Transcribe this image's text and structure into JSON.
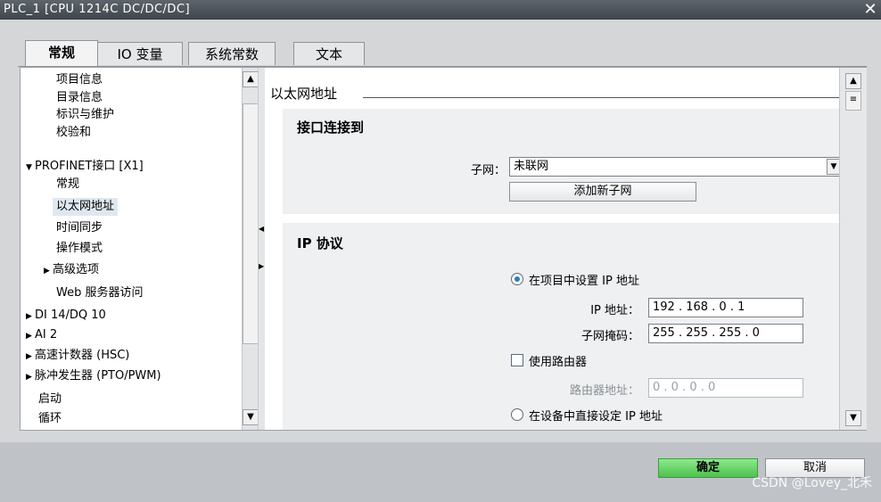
{
  "window": {
    "title": "PLC_1 [CPU 1214C DC/DC/DC]"
  },
  "tabs": [
    {
      "label": "常规"
    },
    {
      "label": "IO 变量"
    },
    {
      "label": "系统常数"
    },
    {
      "label": "文本"
    }
  ],
  "tree": {
    "items": [
      {
        "label": "项目信息",
        "expander": ""
      },
      {
        "label": "目录信息",
        "expander": ""
      },
      {
        "label": "标识与维护",
        "expander": ""
      },
      {
        "label": "校验和",
        "expander": ""
      },
      {
        "label": "PROFINET接口 [X1]",
        "expander": "▼"
      },
      {
        "label": "常规",
        "expander": ""
      },
      {
        "label": "以太网地址",
        "expander": ""
      },
      {
        "label": "时间同步",
        "expander": ""
      },
      {
        "label": "操作模式",
        "expander": ""
      },
      {
        "label": "高级选项",
        "expander": "▶"
      },
      {
        "label": "Web 服务器访问",
        "expander": ""
      },
      {
        "label": "DI 14/DQ 10",
        "expander": "▶"
      },
      {
        "label": "AI 2",
        "expander": "▶"
      },
      {
        "label": "高速计数器 (HSC)",
        "expander": "▶"
      },
      {
        "label": "脉冲发生器 (PTO/PWM)",
        "expander": "▶"
      },
      {
        "label": "启动",
        "expander": ""
      },
      {
        "label": "循环",
        "expander": ""
      }
    ],
    "selected_index": 6
  },
  "content": {
    "section_title": "以太网地址",
    "interface": {
      "heading": "接口连接到",
      "subnet_label": "子网：",
      "subnet_value": "未联网",
      "add_subnet_button": "添加新子网"
    },
    "ip": {
      "heading": "IP 协议",
      "option_project": "在项目中设置 IP 地址",
      "ip_label": "IP 地址：",
      "ip_value": "192 . 168 . 0    . 1",
      "mask_label": "子网掩码：",
      "mask_value": "255 . 255 . 255 . 0",
      "use_router_label": "使用路由器",
      "router_label": "路由器地址：",
      "router_value": "0    . 0    . 0    . 0",
      "option_device": "在设备中直接设定 IP 地址"
    }
  },
  "footer": {
    "ok_label": "确定",
    "cancel_label": "取消"
  },
  "watermark": "CSDN @Lovey_北禾",
  "colors": {
    "accent": "#2f78c4",
    "ok_green": "#5ccf5c",
    "titlebar": "#4a5158"
  }
}
